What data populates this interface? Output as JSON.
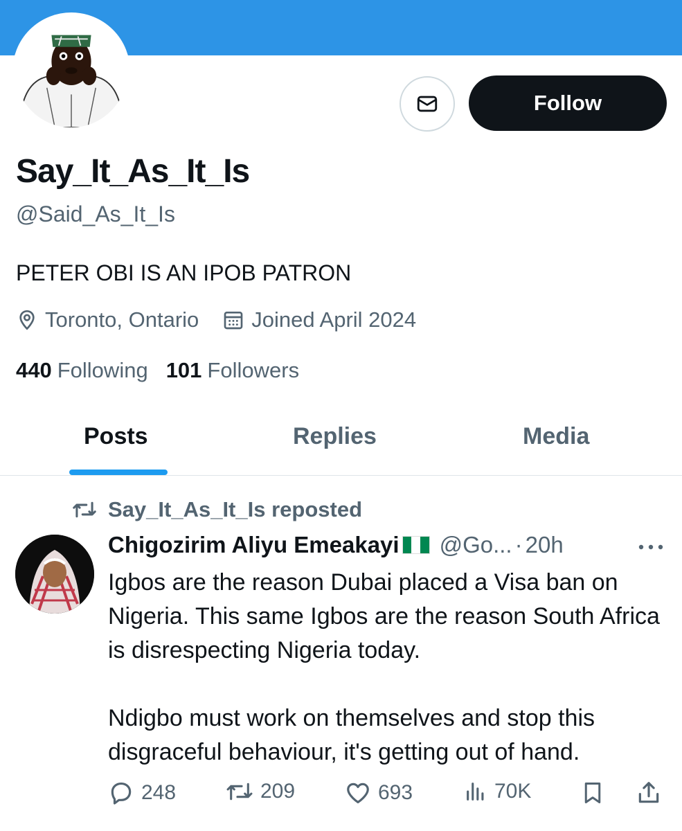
{
  "profile": {
    "display_name": "Say_It_As_It_Is",
    "handle": "@Said_As_It_Is",
    "bio": "PETER OBI IS AN IPOB PATRON",
    "location": "Toronto, Ontario",
    "joined": "Joined April 2024",
    "following_count": "440",
    "following_label": "Following",
    "followers_count": "101",
    "followers_label": "Followers",
    "follow_label": "Follow"
  },
  "tabs": [
    {
      "label": "Posts",
      "active": true
    },
    {
      "label": "Replies",
      "active": false
    },
    {
      "label": "Media",
      "active": false
    }
  ],
  "post": {
    "repost_label": "Say_It_As_It_Is reposted",
    "author_name": "Chigozirim Aliyu Emeakayi",
    "author_handle": "@Go...",
    "time": "20h",
    "paragraphs": [
      "Igbos are the reason Dubai placed a Visa ban on Nigeria. This same Igbos are the reason South Africa is disrespecting Nigeria today.",
      "Ndigbo must work on themselves and stop this disgraceful behaviour, it's getting out of hand."
    ],
    "replies": "248",
    "reposts": "209",
    "likes": "693",
    "views": "70K"
  },
  "icons": {
    "location": "location-pin-icon",
    "calendar": "calendar-icon",
    "message": "envelope-icon",
    "repost": "repost-icon",
    "reply": "reply-icon",
    "like": "heart-icon",
    "views": "views-icon",
    "bookmark": "bookmark-icon",
    "share": "share-icon",
    "more": "more-icon"
  },
  "colors": {
    "banner": "#2d94e6",
    "accent": "#1d9bf0",
    "text_primary": "#0f1419",
    "text_secondary": "#536471",
    "flag_green": "#008751"
  }
}
